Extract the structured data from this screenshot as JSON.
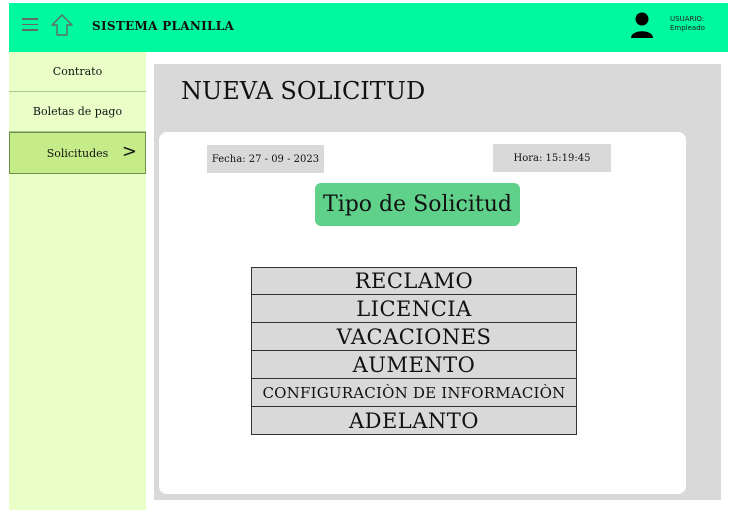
{
  "header": {
    "app_title": "SISTEMA PLANILLA",
    "user_line1": "USUARIO:",
    "user_line2": "Empleado",
    "background_color": "#00f99e"
  },
  "sidebar": {
    "items": [
      {
        "label": "Contrato",
        "active": false
      },
      {
        "label": "Boletas de pago",
        "active": false
      },
      {
        "label": "Solicitudes",
        "active": true
      }
    ],
    "active_chevron": ">"
  },
  "main": {
    "page_title": "NUEVA SOLICITUD",
    "fecha": "Fecha: 27 - 09 - 2023",
    "hora": "Hora: 15:19:45",
    "type_title": "Tipo de Solicitud",
    "options": [
      "RECLAMO",
      "LICENCIA",
      "VACACIONES",
      "AUMENTO",
      "CONFIGURACIÒN DE INFORMACIÒN",
      "ADELANTO"
    ]
  },
  "icons": {
    "menu": "hamburger-menu-icon",
    "home": "home-icon",
    "user": "user-icon"
  }
}
